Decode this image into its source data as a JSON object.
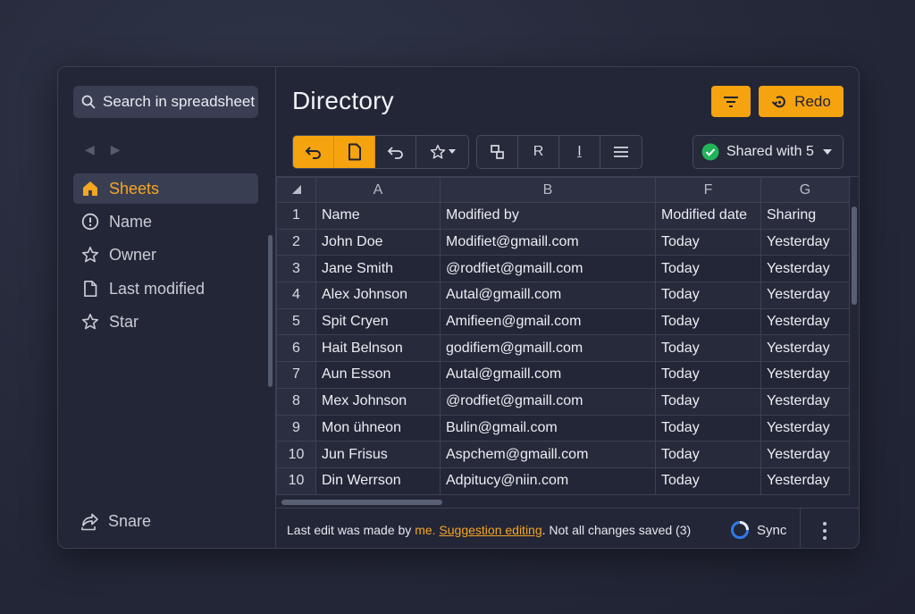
{
  "sidebar": {
    "search_placeholder": "Search in spreadsheet",
    "items": [
      {
        "label": "Sheets",
        "icon": "home-icon",
        "active": true
      },
      {
        "label": "Name",
        "icon": "info-icon",
        "active": false
      },
      {
        "label": "Owner",
        "icon": "star-icon",
        "active": false
      },
      {
        "label": "Last modified",
        "icon": "document-icon",
        "active": false
      },
      {
        "label": "Star",
        "icon": "star-icon",
        "active": false
      }
    ],
    "share_label": "Snare"
  },
  "header": {
    "title": "Directory",
    "redo_label": "Redo",
    "shared_label": "Shared with 5"
  },
  "toolbar": {
    "format_buttons": [
      "R",
      "I"
    ]
  },
  "grid": {
    "column_headers": [
      "A",
      "B",
      "F",
      "G"
    ],
    "header_row_number": "1",
    "header_cells": [
      "Name",
      "Modified by",
      "Modified date",
      "Sharing"
    ],
    "rows": [
      {
        "num": "2",
        "cells": [
          "John Doe",
          "Modifiet@gmaill.com",
          "Today",
          "Yesterday"
        ]
      },
      {
        "num": "3",
        "cells": [
          "Jane Smith",
          "@rodfiet@gmaill.com",
          "Today",
          "Yesterday"
        ]
      },
      {
        "num": "4",
        "cells": [
          "Alex Johnson",
          "Autal@gmaill.com",
          "Today",
          "Yesterday"
        ]
      },
      {
        "num": "5",
        "cells": [
          "Spit Cryen",
          "Amifieen@gmail.com",
          "Today",
          "Yesterday"
        ]
      },
      {
        "num": "6",
        "cells": [
          "Hait Belnson",
          "godifiem@gmaill.com",
          "Today",
          "Yesterday"
        ]
      },
      {
        "num": "7",
        "cells": [
          "Aun Esson",
          "Autal@gmaill.com",
          "Today",
          "Yesterday"
        ]
      },
      {
        "num": "8",
        "cells": [
          "Mex Johnson",
          "@rodfiet@gmaill.com",
          "Today",
          "Yesterday"
        ]
      },
      {
        "num": "9",
        "cells": [
          "Mon ühneon",
          "Bulin@gmail.com",
          "Today",
          "Yesterday"
        ]
      },
      {
        "num": "10",
        "cells": [
          "Jun Frisus",
          "Aspchem@gmaill.com",
          "Today",
          "Yesterday"
        ]
      },
      {
        "num": "10",
        "cells": [
          "Din Werrson",
          "Adpitucy@niin.com",
          "Today",
          "Yesterday"
        ]
      }
    ]
  },
  "status": {
    "prefix": "Last edit was made by",
    "me": "me.",
    "suggestion": "Suggestion editing",
    "suffix": ". Not all changes saved (3)",
    "sync_label": "Sync"
  },
  "colors": {
    "accent": "#f5a30f",
    "background": "#232636",
    "success": "#22b35a"
  }
}
